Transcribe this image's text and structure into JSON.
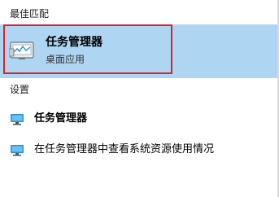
{
  "best_match": {
    "header": "最佳匹配",
    "title": "任务管理器",
    "subtitle": "桌面应用",
    "icon": "task-manager-icon",
    "highlight_color": "#d8232a",
    "selected_bg": "#aed6f3"
  },
  "settings": {
    "header": "设置",
    "items": [
      {
        "label": "任务管理器",
        "icon": "monitor-icon"
      },
      {
        "label": "在任务管理器中查看系统资源使用情况",
        "icon": "monitor-icon"
      }
    ]
  }
}
